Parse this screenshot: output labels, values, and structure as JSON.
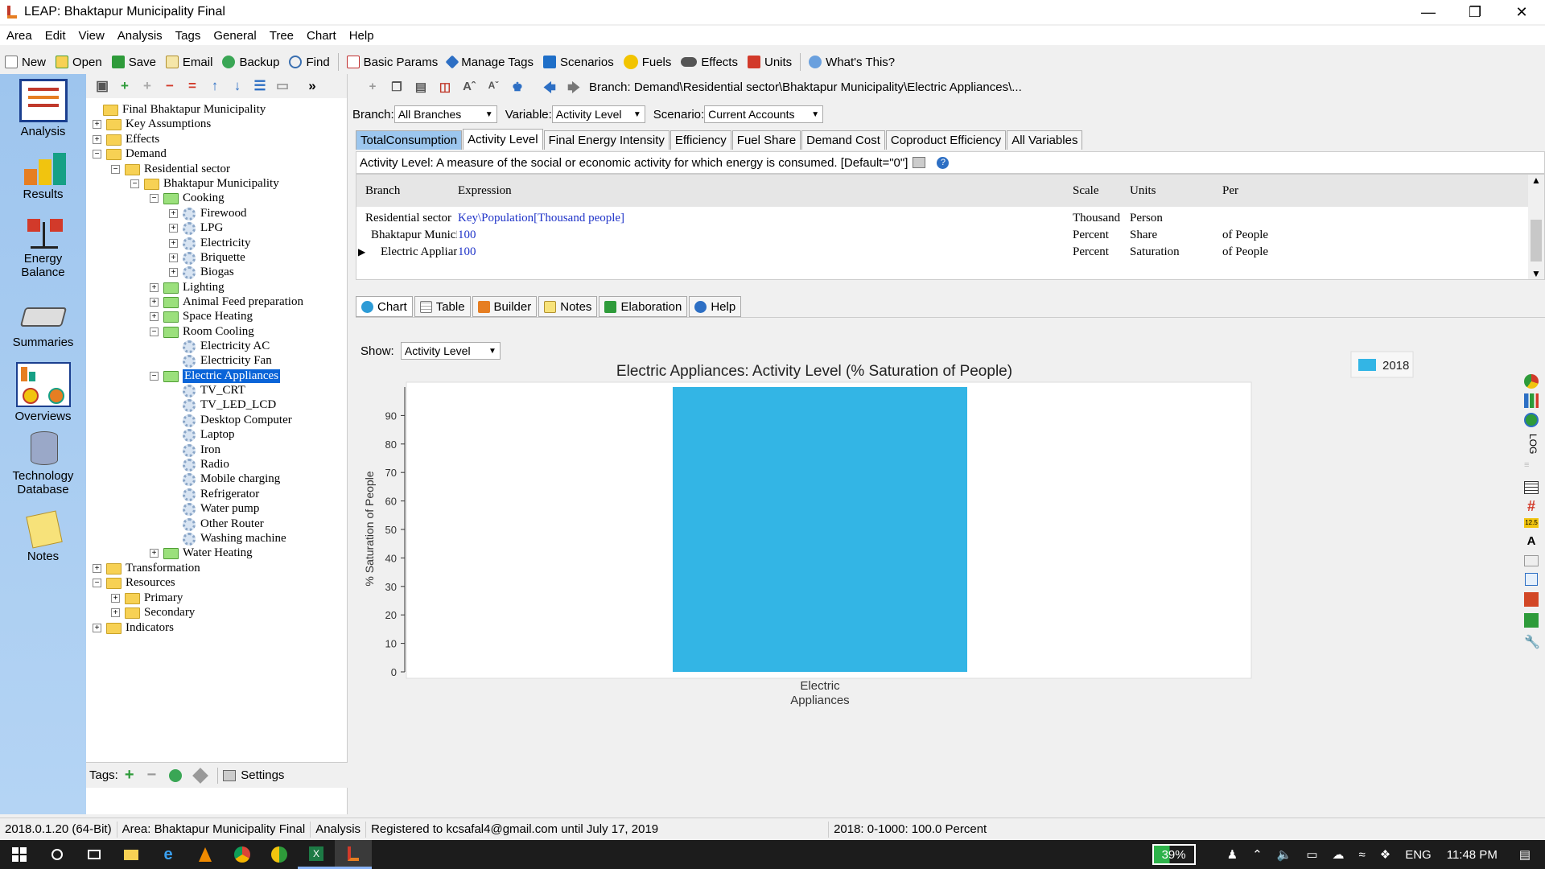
{
  "window": {
    "title": "LEAP: Bhaktapur Municipality Final"
  },
  "menu": [
    "Area",
    "Edit",
    "View",
    "Analysis",
    "Tags",
    "General",
    "Tree",
    "Chart",
    "Help"
  ],
  "toolbar": {
    "new": "New",
    "open": "Open",
    "save": "Save",
    "email": "Email",
    "backup": "Backup",
    "find": "Find",
    "basic_params": "Basic Params",
    "manage_tags": "Manage Tags",
    "scenarios": "Scenarios",
    "fuels": "Fuels",
    "effects": "Effects",
    "units": "Units",
    "whats_this": "What's This?"
  },
  "leftbar": {
    "analysis": "Analysis",
    "results": "Results",
    "energy_balance_1": "Energy",
    "energy_balance_2": "Balance",
    "summaries": "Summaries",
    "overviews": "Overviews",
    "technology_1": "Technology",
    "technology_2": "Database",
    "notes": "Notes"
  },
  "tree": {
    "root": "Final Bhaktapur Municipality",
    "key_assumptions": "Key Assumptions",
    "effects": "Effects",
    "demand": "Demand",
    "residential": "Residential sector",
    "bhaktapur": "Bhaktapur Municipality",
    "cooking": "Cooking",
    "firewood": "Firewood",
    "lpg": "LPG",
    "electricity": "Electricity",
    "briquette": "Briquette",
    "biogas": "Biogas",
    "lighting": "Lighting",
    "animal_feed": "Animal Feed preparation",
    "space_heating": "Space  Heating",
    "room_cooling": "Room Cooling",
    "electricity_ac": "Electricity AC",
    "electricity_fan": "Electricity Fan",
    "electric_appliances": "Electric Appliances",
    "tv_crt": "TV_CRT",
    "tv_led": "TV_LED_LCD",
    "desktop": "Desktop Computer",
    "laptop": "Laptop",
    "iron": "Iron",
    "radio": "Radio",
    "mobile": "Mobile charging",
    "refrigerator": "Refrigerator",
    "water_pump": "Water pump",
    "other_router": "Other Router",
    "washing_machine": "Washing machine",
    "water_heating": "Water Heating",
    "transformation": "Transformation",
    "resources": "Resources",
    "primary": "Primary",
    "secondary": "Secondary",
    "indicators": "Indicators"
  },
  "tags": {
    "label": "Tags:",
    "settings": "Settings"
  },
  "branch_path": "Branch: Demand\\Residential sector\\Bhaktapur Municipality\\Electric Appliances\\...",
  "selectors": {
    "branch_label": "Branch:",
    "branch_value": "All Branches",
    "variable_label": "Variable:",
    "variable_value": "Activity Level",
    "scenario_label": "Scenario:",
    "scenario_value": "Current Accounts"
  },
  "variable_tabs": [
    "TotalConsumption",
    "Activity Level",
    "Final Energy Intensity",
    "Efficiency",
    "Fuel Share",
    "Demand Cost",
    "Coproduct Efficiency",
    "All Variables"
  ],
  "description": "Activity Level: A measure of the social or economic activity for which energy is consumed. [Default=\"0\"]",
  "grid": {
    "headers": {
      "branch": "Branch",
      "expression": "Expression",
      "scale": "Scale",
      "units": "Units",
      "per": "Per"
    },
    "rows": [
      {
        "branch": "Residential sector",
        "expression": "Key\\Population[Thousand people]",
        "scale": "Thousand",
        "units": "Person",
        "per": ""
      },
      {
        "branch": "Bhaktapur Municipal",
        "expression": "100",
        "scale": "Percent",
        "units": "Share",
        "per": "of People"
      },
      {
        "branch": "Electric Appliances",
        "expression": "100",
        "scale": "Percent",
        "units": "Saturation",
        "per": "of People"
      }
    ]
  },
  "bottom_tabs": [
    "Chart",
    "Table",
    "Builder",
    "Notes",
    "Elaboration",
    "Help"
  ],
  "show": {
    "label": "Show:",
    "value": "Activity Level"
  },
  "chart_data": {
    "type": "bar",
    "title": "Electric Appliances: Activity Level (% Saturation of People)",
    "ylabel": "% Saturation of People",
    "xlabel": "",
    "categories": [
      "Electric Appliances"
    ],
    "category_lines": [
      "Electric",
      "Appliances"
    ],
    "series": [
      {
        "name": "2018",
        "values": [
          100
        ],
        "color": "#33b5e5"
      }
    ],
    "ylim": [
      0,
      100
    ],
    "yticks": [
      0,
      10,
      20,
      30,
      40,
      50,
      60,
      70,
      80,
      90
    ],
    "legend": "top-right",
    "grid": false
  },
  "side_strip": {
    "log_label": "LOG",
    "value_badge": "12.5"
  },
  "status": {
    "version": "2018.0.1.20 (64-Bit)",
    "area": "Area: Bhaktapur Municipality Final",
    "view": "Analysis",
    "registered": "Registered to kcsafal4@gmail.com until July 17, 2019",
    "info": "2018: 0-1000: 100.0 Percent"
  },
  "taskbar": {
    "battery": "39%",
    "lang": "ENG",
    "time": "11:48 PM"
  },
  "colors": {
    "accent": "#33b5e5",
    "selection": "#0a64d8",
    "tab_blue": "#9cc6ee"
  }
}
